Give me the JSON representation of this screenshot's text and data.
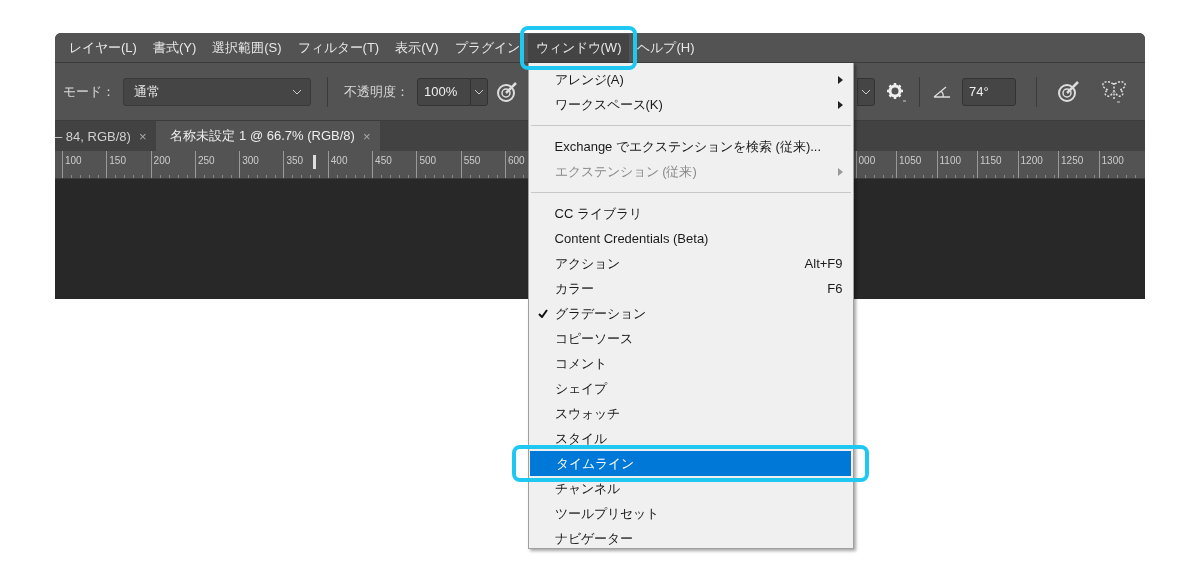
{
  "menu_bar": [
    {
      "label": "レイヤー(L)",
      "selected": false
    },
    {
      "label": "書式(Y)",
      "selected": false
    },
    {
      "label": "選択範囲(S)",
      "selected": false
    },
    {
      "label": "フィルター(T)",
      "selected": false
    },
    {
      "label": "表示(V)",
      "selected": false
    },
    {
      "label": "プラグイン",
      "selected": false
    },
    {
      "label": "ウィンドウ(W)",
      "selected": true
    },
    {
      "label": "ヘルプ(H)",
      "selected": false
    }
  ],
  "options_bar": {
    "mode_label": "モード：",
    "mode_value": "通常",
    "opacity_label": "不透明度：",
    "opacity_value": "100%",
    "angle_value": "74°"
  },
  "document_tabs": [
    {
      "label": "– 84, RGB/8)",
      "close": "×",
      "selected": false
    },
    {
      "label": "名称未設定 1 @ 66.7% (RGB/8)",
      "close": "×",
      "selected": true
    }
  ],
  "ruler": {
    "left_labels": [
      "100",
      "150",
      "200",
      "250",
      "300",
      "350",
      "400",
      "450",
      "500",
      "550",
      "600"
    ],
    "right_labels": [
      "000",
      "1050",
      "1100",
      "1150",
      "1200",
      "1250",
      "1300"
    ]
  },
  "window_menu": {
    "sections": [
      [
        {
          "label": "アレンジ(A)",
          "submenu": true,
          "checked": false,
          "disabled": false,
          "selected": false
        },
        {
          "label": "ワークスペース(K)",
          "submenu": true,
          "checked": false,
          "disabled": false,
          "selected": false
        }
      ],
      [
        {
          "label": "Exchange でエクステンションを検索 (従来)...",
          "submenu": false,
          "checked": false,
          "disabled": false,
          "selected": false
        },
        {
          "label": "エクステンション (従来)",
          "submenu": true,
          "checked": false,
          "disabled": true,
          "selected": false
        }
      ],
      [
        {
          "label": "CC ライブラリ",
          "submenu": false,
          "checked": false,
          "disabled": false,
          "selected": false
        },
        {
          "label": "Content Credentials (Beta)",
          "submenu": false,
          "checked": false,
          "disabled": false,
          "selected": false
        },
        {
          "label": "アクション",
          "shortcut": "Alt+F9",
          "submenu": false,
          "checked": false,
          "disabled": false,
          "selected": false
        },
        {
          "label": "カラー",
          "shortcut": "F6",
          "submenu": false,
          "checked": false,
          "disabled": false,
          "selected": false
        },
        {
          "label": "グラデーション",
          "submenu": false,
          "checked": true,
          "disabled": false,
          "selected": false
        },
        {
          "label": "コピーソース",
          "submenu": false,
          "checked": false,
          "disabled": false,
          "selected": false
        },
        {
          "label": "コメント",
          "submenu": false,
          "checked": false,
          "disabled": false,
          "selected": false
        },
        {
          "label": "シェイプ",
          "submenu": false,
          "checked": false,
          "disabled": false,
          "selected": false
        },
        {
          "label": "スウォッチ",
          "submenu": false,
          "checked": false,
          "disabled": false,
          "selected": false
        },
        {
          "label": "スタイル",
          "submenu": false,
          "checked": false,
          "disabled": false,
          "selected": false
        },
        {
          "label": "タイムライン",
          "submenu": false,
          "checked": false,
          "disabled": false,
          "selected": true
        },
        {
          "label": "チャンネル",
          "submenu": false,
          "checked": false,
          "disabled": false,
          "selected": false
        },
        {
          "label": "ツールプリセット",
          "submenu": false,
          "checked": false,
          "disabled": false,
          "selected": false
        },
        {
          "label": "ナビゲーター",
          "submenu": false,
          "checked": false,
          "disabled": false,
          "selected": false
        }
      ]
    ]
  }
}
